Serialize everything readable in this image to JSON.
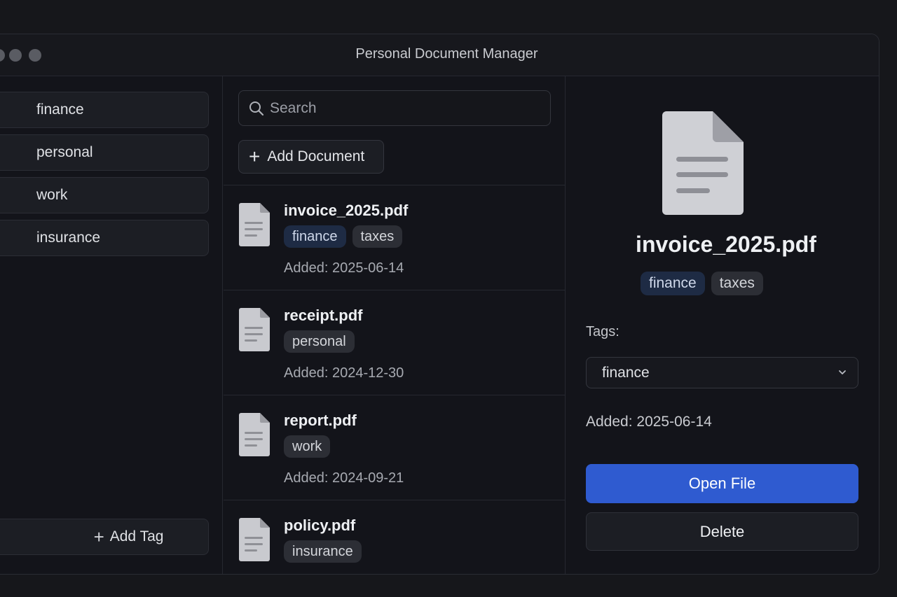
{
  "window": {
    "title": "Personal Document Manager"
  },
  "sidebar": {
    "tags": [
      {
        "label": "finance"
      },
      {
        "label": "personal"
      },
      {
        "label": "work"
      },
      {
        "label": "insurance"
      }
    ],
    "add_tag_label": "Add Tag"
  },
  "list": {
    "search_placeholder": "Search",
    "add_document_label": "Add Document",
    "documents": [
      {
        "name": "invoice_2025.pdf",
        "tags": [
          "finance",
          "taxes"
        ],
        "added": "Added: 2025-06-14"
      },
      {
        "name": "receipt.pdf",
        "tags": [
          "personal"
        ],
        "added": "Added: 2024-12-30"
      },
      {
        "name": "report.pdf",
        "tags": [
          "work"
        ],
        "added": "Added: 2024-09-21"
      },
      {
        "name": "policy.pdf",
        "tags": [
          "insurance"
        ],
        "added": ""
      }
    ]
  },
  "detail": {
    "name": "invoice_2025.pdf",
    "tags": [
      "finance",
      "taxes"
    ],
    "tags_label": "Tags:",
    "selected_tag": "finance",
    "added": "Added: 2025-06-14",
    "open_label": "Open File",
    "delete_label": "Delete"
  },
  "colors": {
    "accent": "#2f5bd0",
    "background": "#13141a",
    "finance_chip": "#1e2b44"
  },
  "icons": {
    "search": "search-icon",
    "add": "plus-icon",
    "document": "document-icon",
    "dropdown": "chevron-down-icon"
  }
}
